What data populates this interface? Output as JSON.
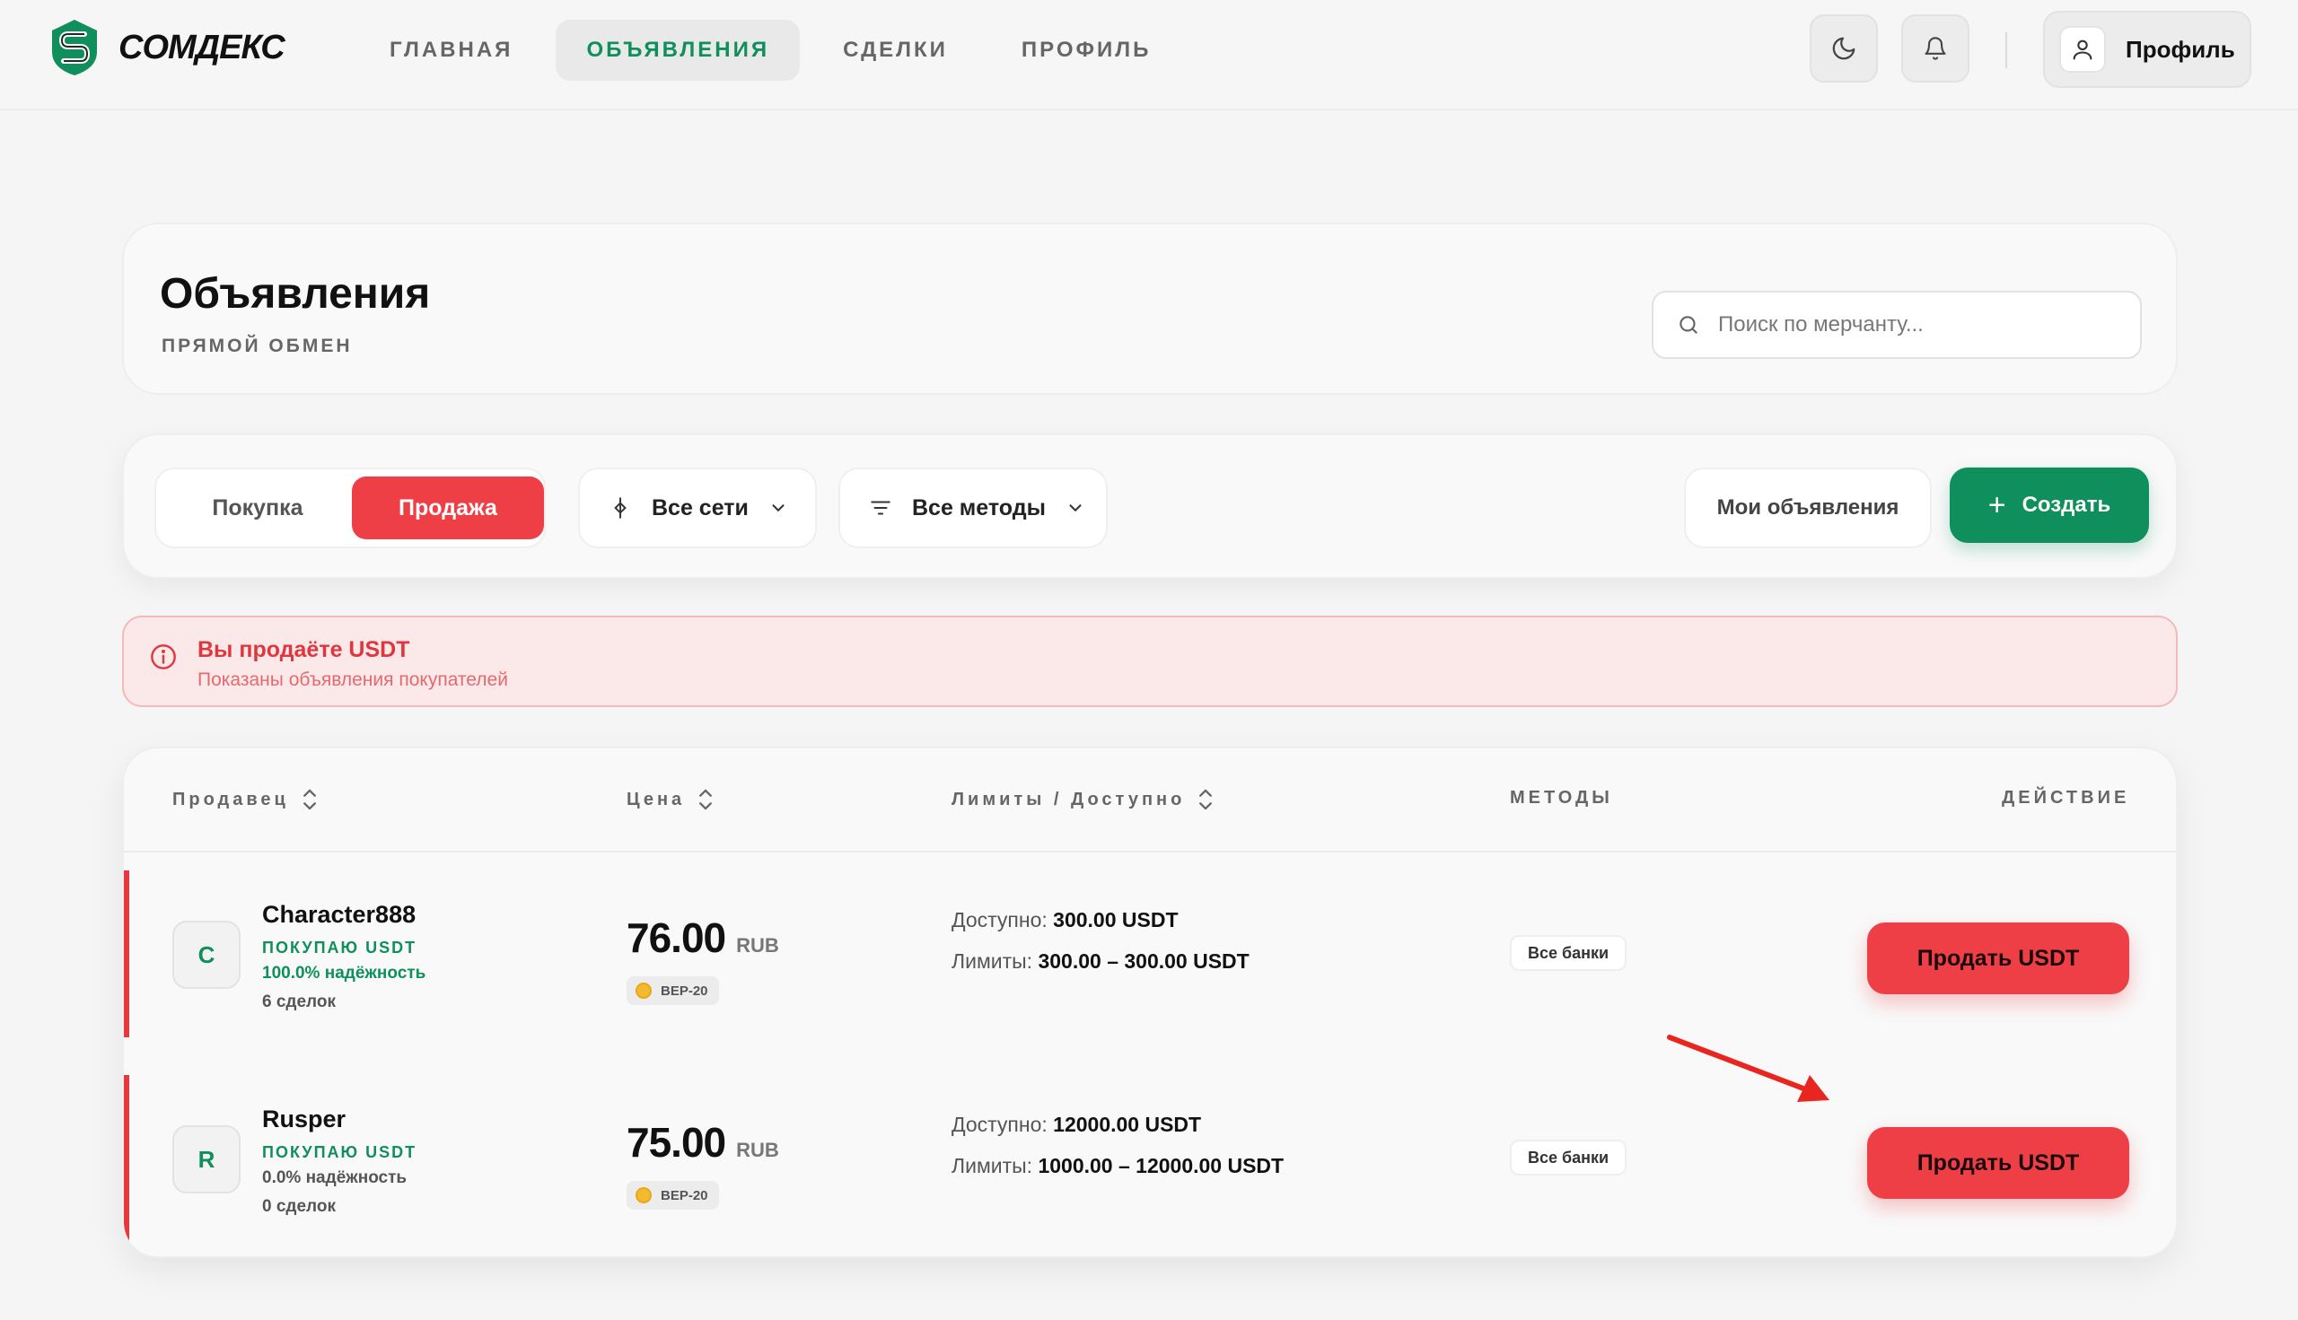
{
  "brand": {
    "name": "СОМДЕКС",
    "logo_icon": "s-shield-logo",
    "accent": "#0f8f5c",
    "danger": "#ef3f46"
  },
  "nav": {
    "items": [
      {
        "label": "ГЛАВНАЯ"
      },
      {
        "label": "ОБЪЯВЛЕНИЯ",
        "active": true
      },
      {
        "label": "СДЕЛКИ"
      },
      {
        "label": "ПРОФИЛЬ"
      }
    ]
  },
  "header": {
    "theme_icon": "moon-icon",
    "bell_icon": "bell-icon",
    "profile_label": "Профиль"
  },
  "page": {
    "title": "Объявления",
    "subtitle": "ПРЯМОЙ ОБМЕН",
    "search_placeholder": "Поиск по мерчанту..."
  },
  "filters": {
    "buy_label": "Покупка",
    "sell_label": "Продажа",
    "networks_label": "Все сети",
    "methods_label": "Все методы",
    "my_ads_label": "Мои объявления",
    "create_label": "Создать"
  },
  "alert": {
    "title": "Вы продаёте USDT",
    "text": "Показаны объявления покупателей"
  },
  "table": {
    "headers": {
      "seller": "Продавец",
      "price": "Цена",
      "limits": "Лимиты / Доступно",
      "methods": "МЕТОДЫ",
      "action": "ДЕЙСТВИЕ"
    },
    "rows": [
      {
        "initial": "C",
        "name": "Character888",
        "role": "ПОКУПАЮ USDT",
        "reliability": "100.0% надёжность",
        "reliability_color": "#0f8f5c",
        "deals": "6 сделок",
        "price": "76.00",
        "currency": "RUB",
        "network": "BEP-20",
        "available_label": "Доступно:",
        "available": "300.00 USDT",
        "limits_label": "Лимиты:",
        "limits": "300.00 – 300.00 USDT",
        "methods": "Все банки",
        "action": "Продать USDT"
      },
      {
        "initial": "R",
        "name": "Rusper",
        "role": "ПОКУПАЮ USDT",
        "reliability": "0.0% надёжность",
        "reliability_color": "#555555",
        "deals": "0 сделок",
        "price": "75.00",
        "currency": "RUB",
        "network": "BEP-20",
        "available_label": "Доступно:",
        "available": "12000.00 USDT",
        "limits_label": "Лимиты:",
        "limits": "1000.00 – 12000.00 USDT",
        "methods": "Все банки",
        "action": "Продать USDT"
      }
    ]
  }
}
